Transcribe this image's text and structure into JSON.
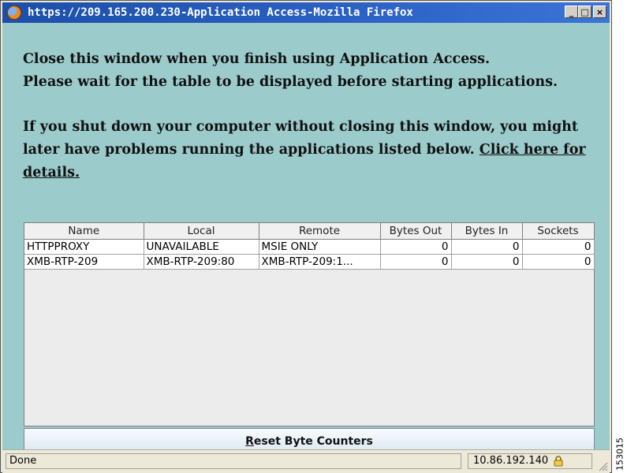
{
  "window": {
    "title": "https://209.165.200.230-Application Access-Mozilla Firefox",
    "buttons": {
      "minimize": "_",
      "maximize": "□",
      "close": "×"
    }
  },
  "message": {
    "line1": "Close this window when you finish using Application Access.",
    "line2": "Please wait for the table to be displayed before starting applications.",
    "warning": "If you shut down your computer without closing this window, you might later have problems running the applications listed below.",
    "link_text": "Click here for details."
  },
  "table": {
    "columns": [
      "Name",
      "Local",
      "Remote",
      "Bytes Out",
      "Bytes In",
      "Sockets"
    ],
    "rows": [
      {
        "name": "HTTPPROXY",
        "local": "UNAVAILABLE",
        "remote": "MSIE ONLY",
        "bytes_out": "0",
        "bytes_in": "0",
        "sockets": "0"
      },
      {
        "name": "XMB-RTP-209",
        "local": "XMB-RTP-209:80",
        "remote": "XMB-RTP-209:1...",
        "bytes_out": "0",
        "bytes_in": "0",
        "sockets": "0"
      }
    ]
  },
  "reset_button": {
    "accesskey": "R",
    "label_rest": "eset Byte Counters"
  },
  "statusbar": {
    "status": "Done",
    "host": "10.86.192.140"
  },
  "figure_id": "153015",
  "icons": {
    "app": "firefox-icon",
    "lock": "lock-icon",
    "grip": "resize-grip-icon"
  }
}
